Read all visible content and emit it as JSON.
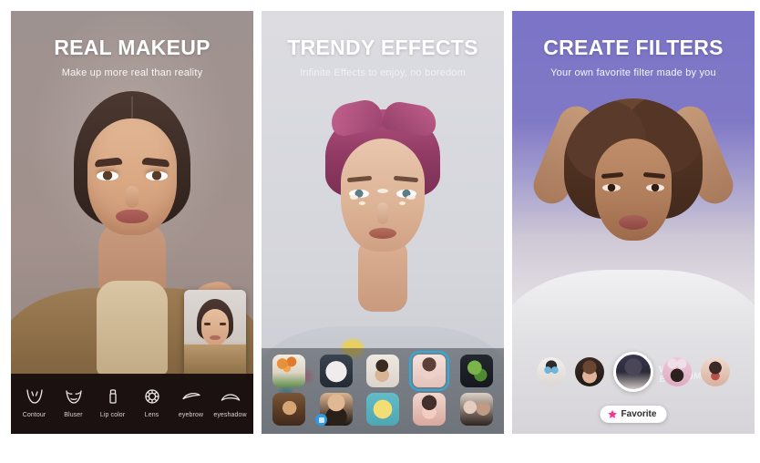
{
  "app": {
    "background": "#ffffff",
    "panel_count": 3
  },
  "panels": [
    {
      "id": "real-makeup",
      "title": "REAL MAKEUP",
      "subtitle": "Make up more real than reality",
      "background_color": "#9d918f",
      "toolbar": {
        "items": [
          {
            "label": "Contour",
            "icon": "contour-icon"
          },
          {
            "label": "Bluser",
            "icon": "blusher-icon"
          },
          {
            "label": "Lip color",
            "icon": "lipstick-icon"
          },
          {
            "label": "Lens",
            "icon": "lens-icon"
          },
          {
            "label": "eyebrow",
            "icon": "eyebrow-icon"
          },
          {
            "label": "eyeshadow",
            "icon": "eyeshadow-icon"
          }
        ]
      },
      "preview_thumbnail": {
        "name": "before-after-preview"
      }
    },
    {
      "id": "trendy-effects",
      "title": "TRENDY EFFECTS",
      "subtitle": "Infinite Effects to enjoy, no boredom",
      "background_color": "#d8d9de",
      "effects_grid": {
        "columns": 5,
        "rows": 2,
        "selected_index": 3,
        "items": [
          {
            "name": "tulips-effect",
            "colors": [
              "#efe6d8",
              "#e8913a",
              "#5e8f4a"
            ]
          },
          {
            "name": "white-mask-effect",
            "colors": [
              "#2b3440",
              "#e9e6e3",
              "#c9a7a0"
            ]
          },
          {
            "name": "portrait-effect",
            "colors": [
              "#ece7e2",
              "#8e6a58",
              "#3a2a24"
            ]
          },
          {
            "name": "glow-girl-effect",
            "colors": [
              "#f2dbd4",
              "#c98a82",
              "#5d4038"
            ]
          },
          {
            "name": "frog-effect",
            "colors": [
              "#1c2026",
              "#79b34a",
              "#3f7a2a"
            ]
          },
          {
            "name": "vintage-effect",
            "colors": [
              "#6b4a32",
              "#c8935c",
              "#3a2418"
            ]
          },
          {
            "name": "beard-effect",
            "colors": [
              "#d8b08c",
              "#3a2a22",
              "#1d1612"
            ]
          },
          {
            "name": "lemon-face-effect",
            "colors": [
              "#5fb8c4",
              "#f2de74",
              "#e8c94e"
            ]
          },
          {
            "name": "blush-girl-effect",
            "colors": [
              "#f0cdc4",
              "#b06a60",
              "#44302a"
            ]
          },
          {
            "name": "duo-girls-effect",
            "colors": [
              "#e6d8cf",
              "#a77f6a",
              "#2f2320"
            ]
          }
        ],
        "selected_border_color": "#29aee0",
        "badge_color": "#2f9ae0"
      }
    },
    {
      "id": "create-filters",
      "title": "CREATE FILTERS",
      "subtitle": "Your own favorite filter made by you",
      "background_color": "#7a73c6",
      "overlay_text": "VERO\nEEKCOME",
      "filter_row": {
        "selected_index": 2,
        "items": [
          {
            "name": "cat-face-filter",
            "colors": [
              "#e9e6e4",
              "#2c2c2c",
              "#6fb6d8"
            ]
          },
          {
            "name": "retro-girl-filter",
            "colors": [
              "#1f1a18",
              "#c98f6e",
              "#e0b29a"
            ]
          },
          {
            "name": "sunglasses-filter",
            "colors": [
              "#2b2a38",
              "#d8cfc9",
              "#4a4658"
            ]
          },
          {
            "name": "bunny-ears-filter",
            "colors": [
              "#e8c9d6",
              "#2b2220",
              "#f0dfe6"
            ]
          },
          {
            "name": "glam-face-filter",
            "colors": [
              "#efd6c8",
              "#b8504c",
              "#3b2a26"
            ]
          }
        ]
      },
      "favorite_button": {
        "label": "Favorite",
        "icon": "star-icon",
        "star_color": "#f5368e",
        "background": "#ffffff"
      }
    }
  ]
}
